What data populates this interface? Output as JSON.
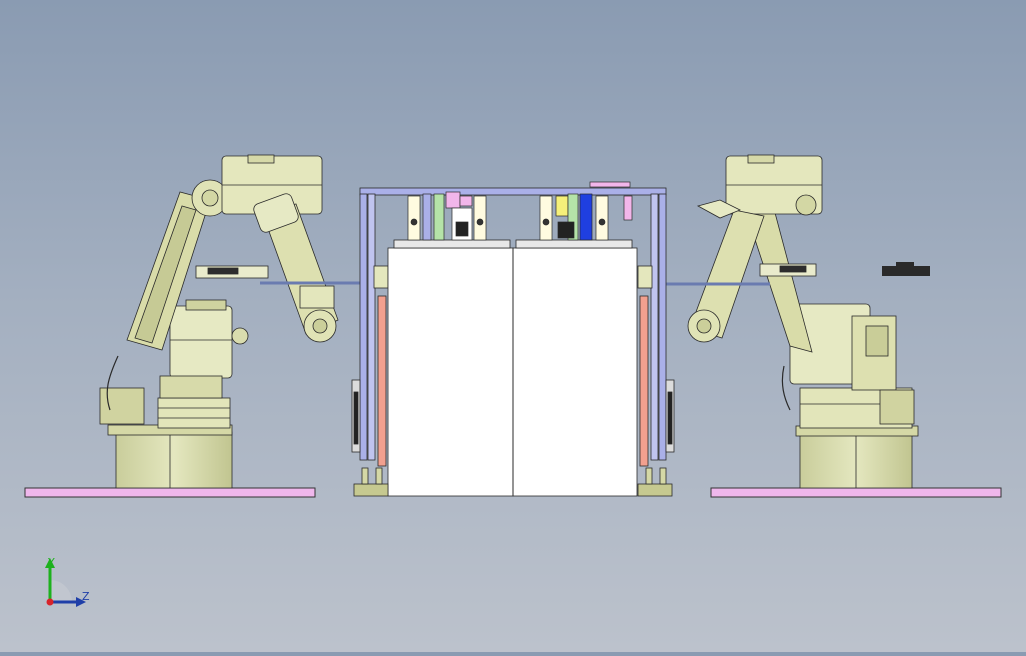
{
  "viewport": {
    "background_top": "#8a9bb2",
    "background_bottom": "#bcc2cc",
    "model_colors": {
      "robot_body": "#dfe3b2",
      "robot_shadow": "#c3c893",
      "base_pad": "#efb7ec",
      "frame": "#aab0e8",
      "cabinet": "#ffffff",
      "rail": "#f2a08f",
      "outline": "#2a2a2a"
    },
    "robots": [
      {
        "name": "left-robot",
        "facing": "right"
      },
      {
        "name": "right-robot",
        "facing": "left"
      }
    ]
  },
  "triad": {
    "y_label": "Y",
    "z_label": "Z",
    "y_color": "#1db11d",
    "z_color": "#1f3fa8",
    "origin_color": "#d8232a"
  }
}
